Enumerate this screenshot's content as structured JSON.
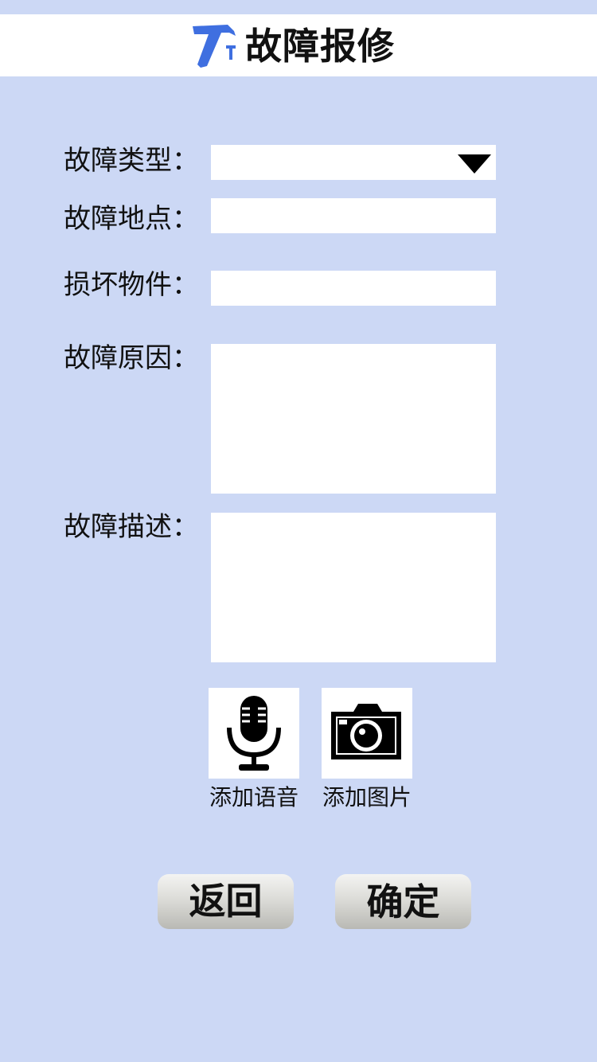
{
  "header": {
    "title": "故障报修",
    "icon": "hammer-icon",
    "icon_color": "#3f6fe0"
  },
  "form": {
    "fault_type": {
      "label": "故障类型：",
      "value": ""
    },
    "fault_location": {
      "label": "故障地点：",
      "value": ""
    },
    "damaged_item": {
      "label": "损坏物件：",
      "value": ""
    },
    "fault_cause": {
      "label": "故障原因：",
      "value": ""
    },
    "fault_description": {
      "label": "故障描述：",
      "value": ""
    }
  },
  "media": {
    "voice": {
      "label": "添加语音",
      "icon": "microphone-icon"
    },
    "photo": {
      "label": "添加图片",
      "icon": "camera-icon"
    }
  },
  "actions": {
    "back_label": "返回",
    "confirm_label": "确定"
  },
  "colors": {
    "background": "#ccd8f5",
    "field": "#ffffff",
    "accent": "#3f6fe0"
  }
}
